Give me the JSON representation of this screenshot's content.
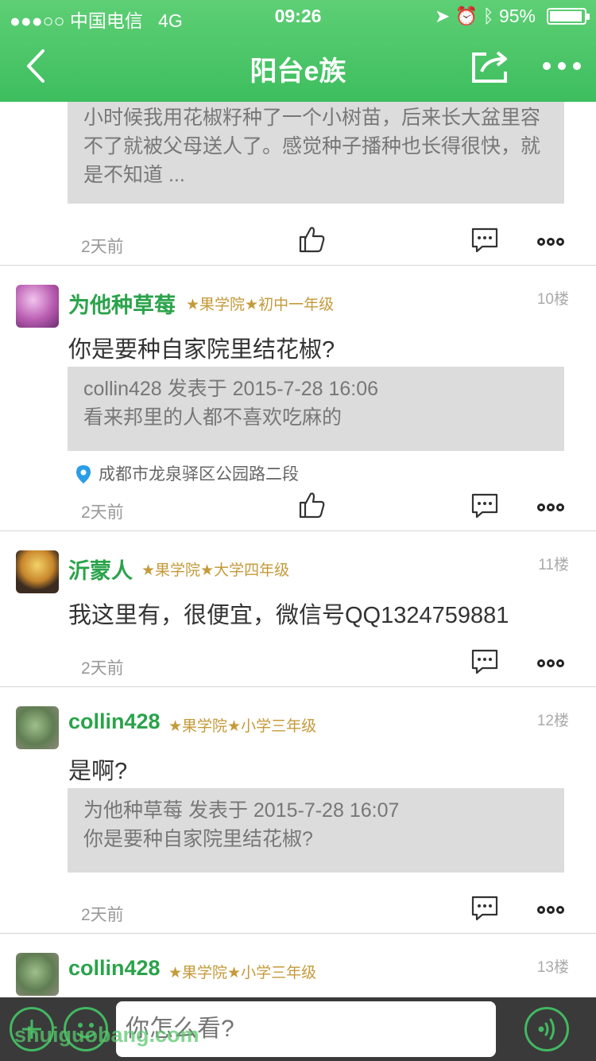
{
  "status": {
    "carrier": "●●●○○ 中国电信",
    "network": "4G",
    "time": "09:26",
    "battery": "95%",
    "battery_fraction": 0.95
  },
  "nav": {
    "title": "阳台e族"
  },
  "posts": [
    {
      "quote": "小时候我用花椒籽种了一个小树苗，后来长大盆里容不了就被父母送人了。感觉种子播种也长得很快，就是不知道 ...",
      "time": "2天前"
    },
    {
      "username": "为他种草莓",
      "rank": "★果学院★初中一年级",
      "floor": "10楼",
      "content": "你是要种自家院里结花椒?",
      "quote_header": "collin428 发表于 2015-7-28 16:06",
      "quote_text": "看来邦里的人都不喜欢吃麻的",
      "location": "成都市龙泉驿区公园路二段",
      "time": "2天前"
    },
    {
      "username": "沂蒙人",
      "rank": "★果学院★大学四年级",
      "floor": "11楼",
      "content": "我这里有，很便宜，微信号QQ1324759881",
      "time": "2天前"
    },
    {
      "username": "collin428",
      "rank": "★果学院★小学三年级",
      "floor": "12楼",
      "content": "是啊?",
      "quote_header": "为他种草莓 发表于 2015-7-28 16:07",
      "quote_text": "你是要种自家院里结花椒?",
      "time": "2天前"
    },
    {
      "username": "collin428",
      "rank": "★果学院★小学三年级",
      "floor": "13楼"
    }
  ],
  "reply": {
    "placeholder": "你怎么看?"
  },
  "watermark": "shuiguobang.com",
  "colors": {
    "brand_green": "#3dbe5f",
    "username_green": "#2aa34a",
    "rank_gold": "#c49a3a"
  }
}
